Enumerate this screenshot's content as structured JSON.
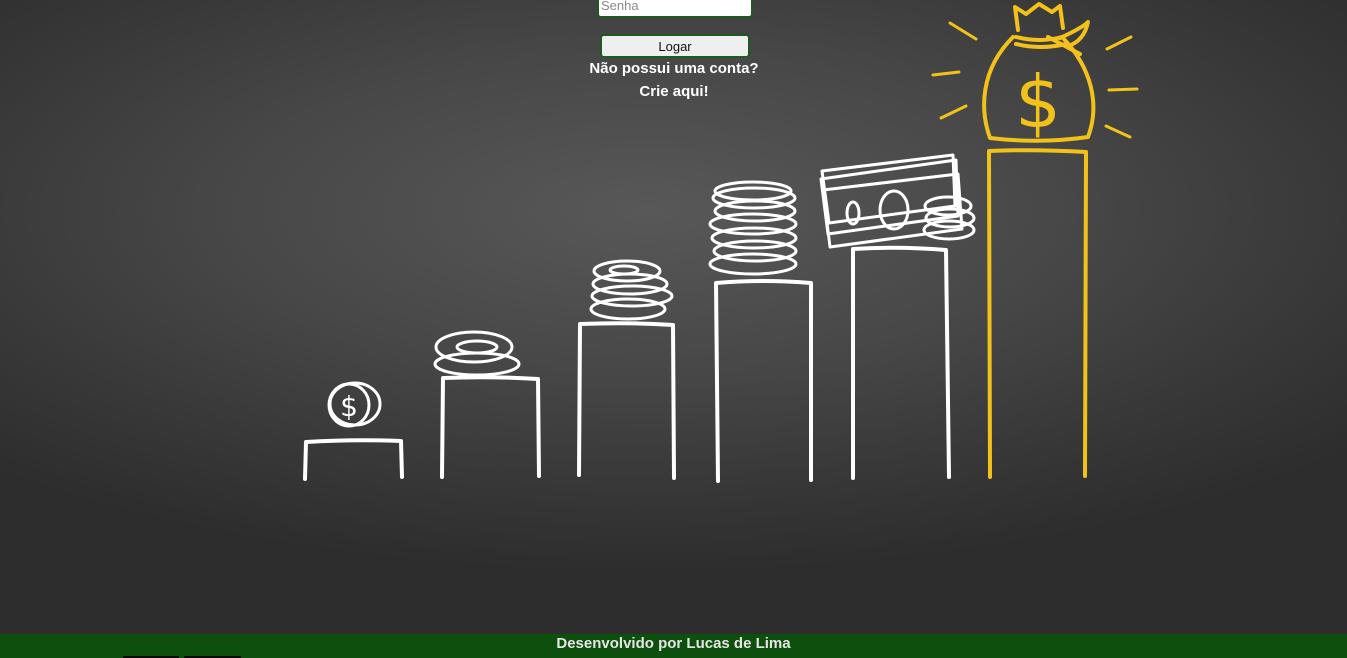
{
  "login": {
    "password_placeholder": "Senha",
    "submit_label": "Logar"
  },
  "signup": {
    "question": "Não possui uma conta?",
    "link_label": "Crie aqui!"
  },
  "footer": {
    "credit": "Desenvolvido por Lucas de Lima"
  },
  "illustration": {
    "chalk_color": "#ffffff",
    "highlight_color": "#f2c21a",
    "accent_green": "#0d4f0d",
    "highlight_symbol": "$",
    "coin_symbol": "$"
  }
}
